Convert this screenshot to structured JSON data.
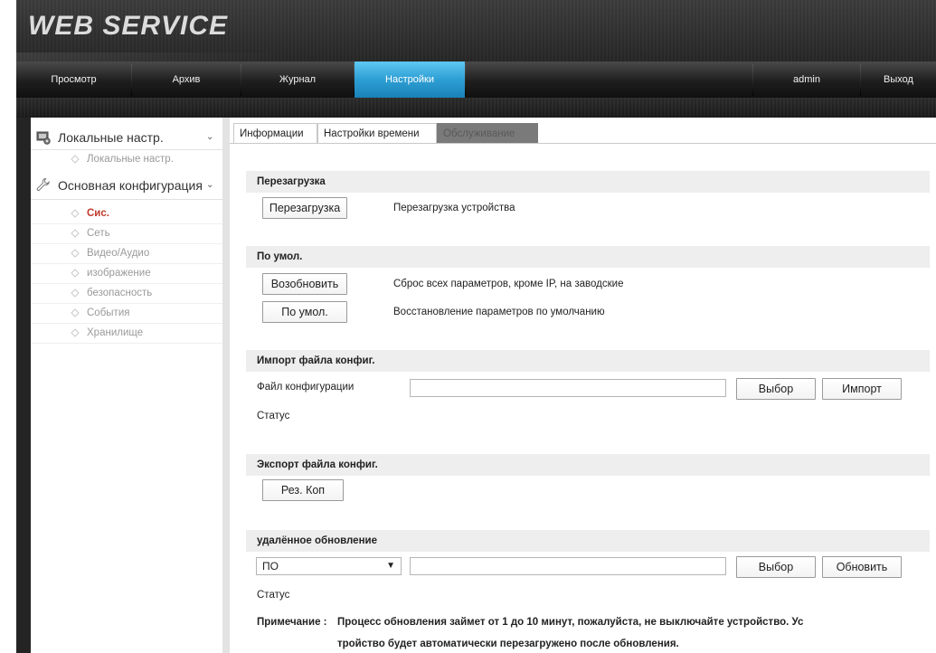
{
  "header": {
    "logo": "WEB  SERVICE"
  },
  "nav": {
    "items": [
      "Просмотр",
      "Архив",
      "Журнал",
      "Настройки"
    ],
    "active": "Настройки",
    "user": "admin",
    "logout": "Выход"
  },
  "sidebar": {
    "section1": {
      "label": "Локальные настр.",
      "icon": "settings-screen-icon"
    },
    "section1_items": [
      "Локальные настр."
    ],
    "section2": {
      "label": "Основная конфигурация",
      "icon": "wrench-icon"
    },
    "section2_items": [
      "Сис.",
      "Сеть",
      "Видео/Аудио",
      "изображение",
      "безопасность",
      "События",
      "Хранилище"
    ],
    "current_item": "Сис."
  },
  "tabs": [
    "Информации",
    "Настройки времени",
    "Обслуживание"
  ],
  "active_tab": "Обслуживание",
  "reboot": {
    "title": "Перезагрузка",
    "button": "Перезагрузка",
    "desc": "Перезагрузка устройства"
  },
  "defaults": {
    "title": "По умол.",
    "restore_button": "Возобновить",
    "restore_desc": "Сброс всех параметров, кроме IP, на заводские",
    "default_button": "По умол.",
    "default_desc": "Восстановление параметров по умолчанию"
  },
  "import": {
    "title": "Импорт файла конфиг.",
    "file_label": "Файл конфигурации",
    "file_value": "",
    "browse_button": "Выбор",
    "import_button": "Импорт",
    "status_label": "Статус"
  },
  "export": {
    "title": "Экспорт файла конфиг.",
    "button": "Рез. Коп"
  },
  "upgrade": {
    "title": "удалённое обновление",
    "select_value": "ПО",
    "file_value": "",
    "browse_button": "Выбор",
    "update_button": "Обновить",
    "status_label": "Статус",
    "note_label": "Примечание :",
    "note_line1": "Процесс обновления займет от 1 до 10 минут, пожалуйста, не выключайте устройство. Ус",
    "note_line2": "тройство будет автоматически перезагружено после обновления."
  }
}
